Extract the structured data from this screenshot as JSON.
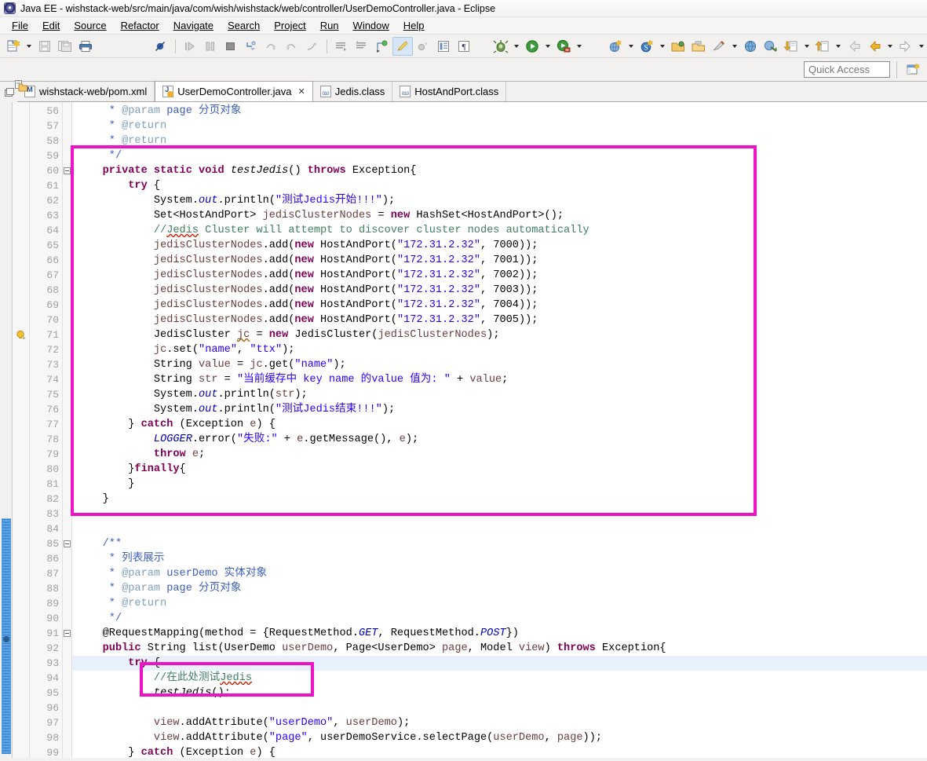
{
  "window": {
    "title": "Java EE - wishstack-web/src/main/java/com/wish/wishstack/web/controller/UserDemoController.java - Eclipse",
    "app_icon": "eclipse-icon"
  },
  "menu": {
    "items": [
      {
        "label": "File"
      },
      {
        "label": "Edit"
      },
      {
        "label": "Source"
      },
      {
        "label": "Refactor"
      },
      {
        "label": "Navigate"
      },
      {
        "label": "Search"
      },
      {
        "label": "Project"
      },
      {
        "label": "Run"
      },
      {
        "label": "Window"
      },
      {
        "label": "Help"
      }
    ]
  },
  "toolbar": {
    "icons": [
      "new-wizard-icon",
      "new-dropdown-caret",
      "save-icon",
      "save-all-icon",
      "print-icon",
      "skip-all-breakpoints-icon",
      "resume-icon",
      "suspend-icon",
      "terminate-icon",
      "step-into-icon",
      "step-over-icon",
      "step-return-icon",
      "drop-to-frame-icon",
      "next-annotation-icon",
      "previous-annotation-icon",
      "last-edit-location-icon",
      "toggle-mark-occurrences-icon",
      "coverage-icon",
      "show-whitespace-icon",
      "block-selection-icon",
      "debug-icon",
      "debug-dropdown-caret",
      "run-icon",
      "run-dropdown-caret",
      "run-server-icon",
      "run-server-dropdown-caret",
      "new-java-project-icon",
      "new-java-project-caret",
      "new-servlet-icon",
      "new-servlet-caret",
      "open-type-icon",
      "open-task-icon",
      "open-resource-icon",
      "open-resource-caret",
      "web-browser-icon",
      "external-tools-icon",
      "import-icon",
      "import-caret",
      "export-icon",
      "export-caret",
      "back-icon",
      "forward-icon",
      "forward-caret",
      "next-icon",
      "next-caret"
    ]
  },
  "quick_access": {
    "placeholder": "Quick Access",
    "value": "",
    "perspective_button": "open-perspective-icon"
  },
  "editor_tabs": {
    "view_menu_icon": "restore-view-icon",
    "tabs": [
      {
        "label": "wishstack-web/pom.xml",
        "icon": "xml-file-icon",
        "active": false,
        "closable": false
      },
      {
        "label": "UserDemoController.java",
        "icon": "java-file-warning-icon",
        "active": true,
        "closable": true,
        "close_glyph": "✕"
      },
      {
        "label": "Jedis.class",
        "icon": "class-file-icon",
        "active": false,
        "closable": false
      },
      {
        "label": "HostAndPort.class",
        "icon": "class-file-icon",
        "active": false,
        "closable": false
      }
    ]
  },
  "sidebar": {
    "package_explorer_icon": "package-explorer-icon",
    "outline_icon": "outline-icon"
  },
  "editor": {
    "first_line": 56,
    "markers": [
      {
        "line": 71,
        "icon": "warning-bulb-icon",
        "name": "quick-fix-warning-marker"
      }
    ],
    "folds": [
      60,
      85,
      91
    ],
    "highlighted_line": 93,
    "annotation_boxes": [
      {
        "name": "test-jedis-method-highlight",
        "from_line": 59,
        "to_line": 83,
        "color": "#ef13c8"
      },
      {
        "name": "test-jedis-call-highlight",
        "from_line": 94,
        "to_line": 95,
        "color": "#ef13c8"
      }
    ],
    "lines": [
      {
        "n": 56,
        "text": "     * @param page 分页对象"
      },
      {
        "n": 57,
        "text": "     * @return"
      },
      {
        "n": 58,
        "text": "     * @return"
      },
      {
        "n": 59,
        "text": "     */"
      },
      {
        "n": 60,
        "text": "    private static void testJedis() throws Exception{"
      },
      {
        "n": 61,
        "text": "        try {"
      },
      {
        "n": 62,
        "text": "            System.out.println(\"测试Jedis开始!!!\");"
      },
      {
        "n": 63,
        "text": "            Set<HostAndPort> jedisClusterNodes = new HashSet<HostAndPort>();"
      },
      {
        "n": 64,
        "text": "            //Jedis Cluster will attempt to discover cluster nodes automatically"
      },
      {
        "n": 65,
        "text": "            jedisClusterNodes.add(new HostAndPort(\"172.31.2.32\", 7000));"
      },
      {
        "n": 66,
        "text": "            jedisClusterNodes.add(new HostAndPort(\"172.31.2.32\", 7001));"
      },
      {
        "n": 67,
        "text": "            jedisClusterNodes.add(new HostAndPort(\"172.31.2.32\", 7002));"
      },
      {
        "n": 68,
        "text": "            jedisClusterNodes.add(new HostAndPort(\"172.31.2.32\", 7003));"
      },
      {
        "n": 69,
        "text": "            jedisClusterNodes.add(new HostAndPort(\"172.31.2.32\", 7004));"
      },
      {
        "n": 70,
        "text": "            jedisClusterNodes.add(new HostAndPort(\"172.31.2.32\", 7005));"
      },
      {
        "n": 71,
        "text": "            JedisCluster jc = new JedisCluster(jedisClusterNodes);"
      },
      {
        "n": 72,
        "text": "            jc.set(\"name\", \"ttx\");"
      },
      {
        "n": 73,
        "text": "            String value = jc.get(\"name\");"
      },
      {
        "n": 74,
        "text": "            String str = \"当前缓存中 key name 的value 值为: \" + value;"
      },
      {
        "n": 75,
        "text": "            System.out.println(str);"
      },
      {
        "n": 76,
        "text": "            System.out.println(\"测试Jedis结束!!!\");"
      },
      {
        "n": 77,
        "text": "        } catch (Exception e) {"
      },
      {
        "n": 78,
        "text": "            LOGGER.error(\"失败:\" + e.getMessage(), e);"
      },
      {
        "n": 79,
        "text": "            throw e;"
      },
      {
        "n": 80,
        "text": "        }finally{"
      },
      {
        "n": 81,
        "text": "        }"
      },
      {
        "n": 82,
        "text": "    }"
      },
      {
        "n": 83,
        "text": ""
      },
      {
        "n": 84,
        "text": ""
      },
      {
        "n": 85,
        "text": "    /**"
      },
      {
        "n": 86,
        "text": "     * 列表展示"
      },
      {
        "n": 87,
        "text": "     * @param userDemo 实体对象"
      },
      {
        "n": 88,
        "text": "     * @param page 分页对象"
      },
      {
        "n": 89,
        "text": "     * @return"
      },
      {
        "n": 90,
        "text": "     */"
      },
      {
        "n": 91,
        "text": "    @RequestMapping(method = {RequestMethod.GET, RequestMethod.POST})"
      },
      {
        "n": 92,
        "text": "    public String list(UserDemo userDemo, Page<UserDemo> page, Model view) throws Exception{"
      },
      {
        "n": 93,
        "text": "        try {"
      },
      {
        "n": 94,
        "text": "            //在此处测试Jedis"
      },
      {
        "n": 95,
        "text": "            testJedis();"
      },
      {
        "n": 96,
        "text": ""
      },
      {
        "n": 97,
        "text": "            view.addAttribute(\"userDemo\", userDemo);"
      },
      {
        "n": 98,
        "text": "            view.addAttribute(\"page\", userDemoService.selectPage(userDemo, page));"
      },
      {
        "n": 99,
        "text": "        } catch (Exception e) {"
      }
    ]
  },
  "colors": {
    "keyword": "#7f0055",
    "string": "#2a00ff",
    "comment": "#3f7f5f",
    "javadoc": "#3f5fbf",
    "javadoc_tag": "#7f9fbf",
    "field": "#0000c0",
    "annotation_box": "#ef13c8",
    "current_line": "#e8f0fb",
    "scrollbar_thumb": "#3b8ddd"
  }
}
